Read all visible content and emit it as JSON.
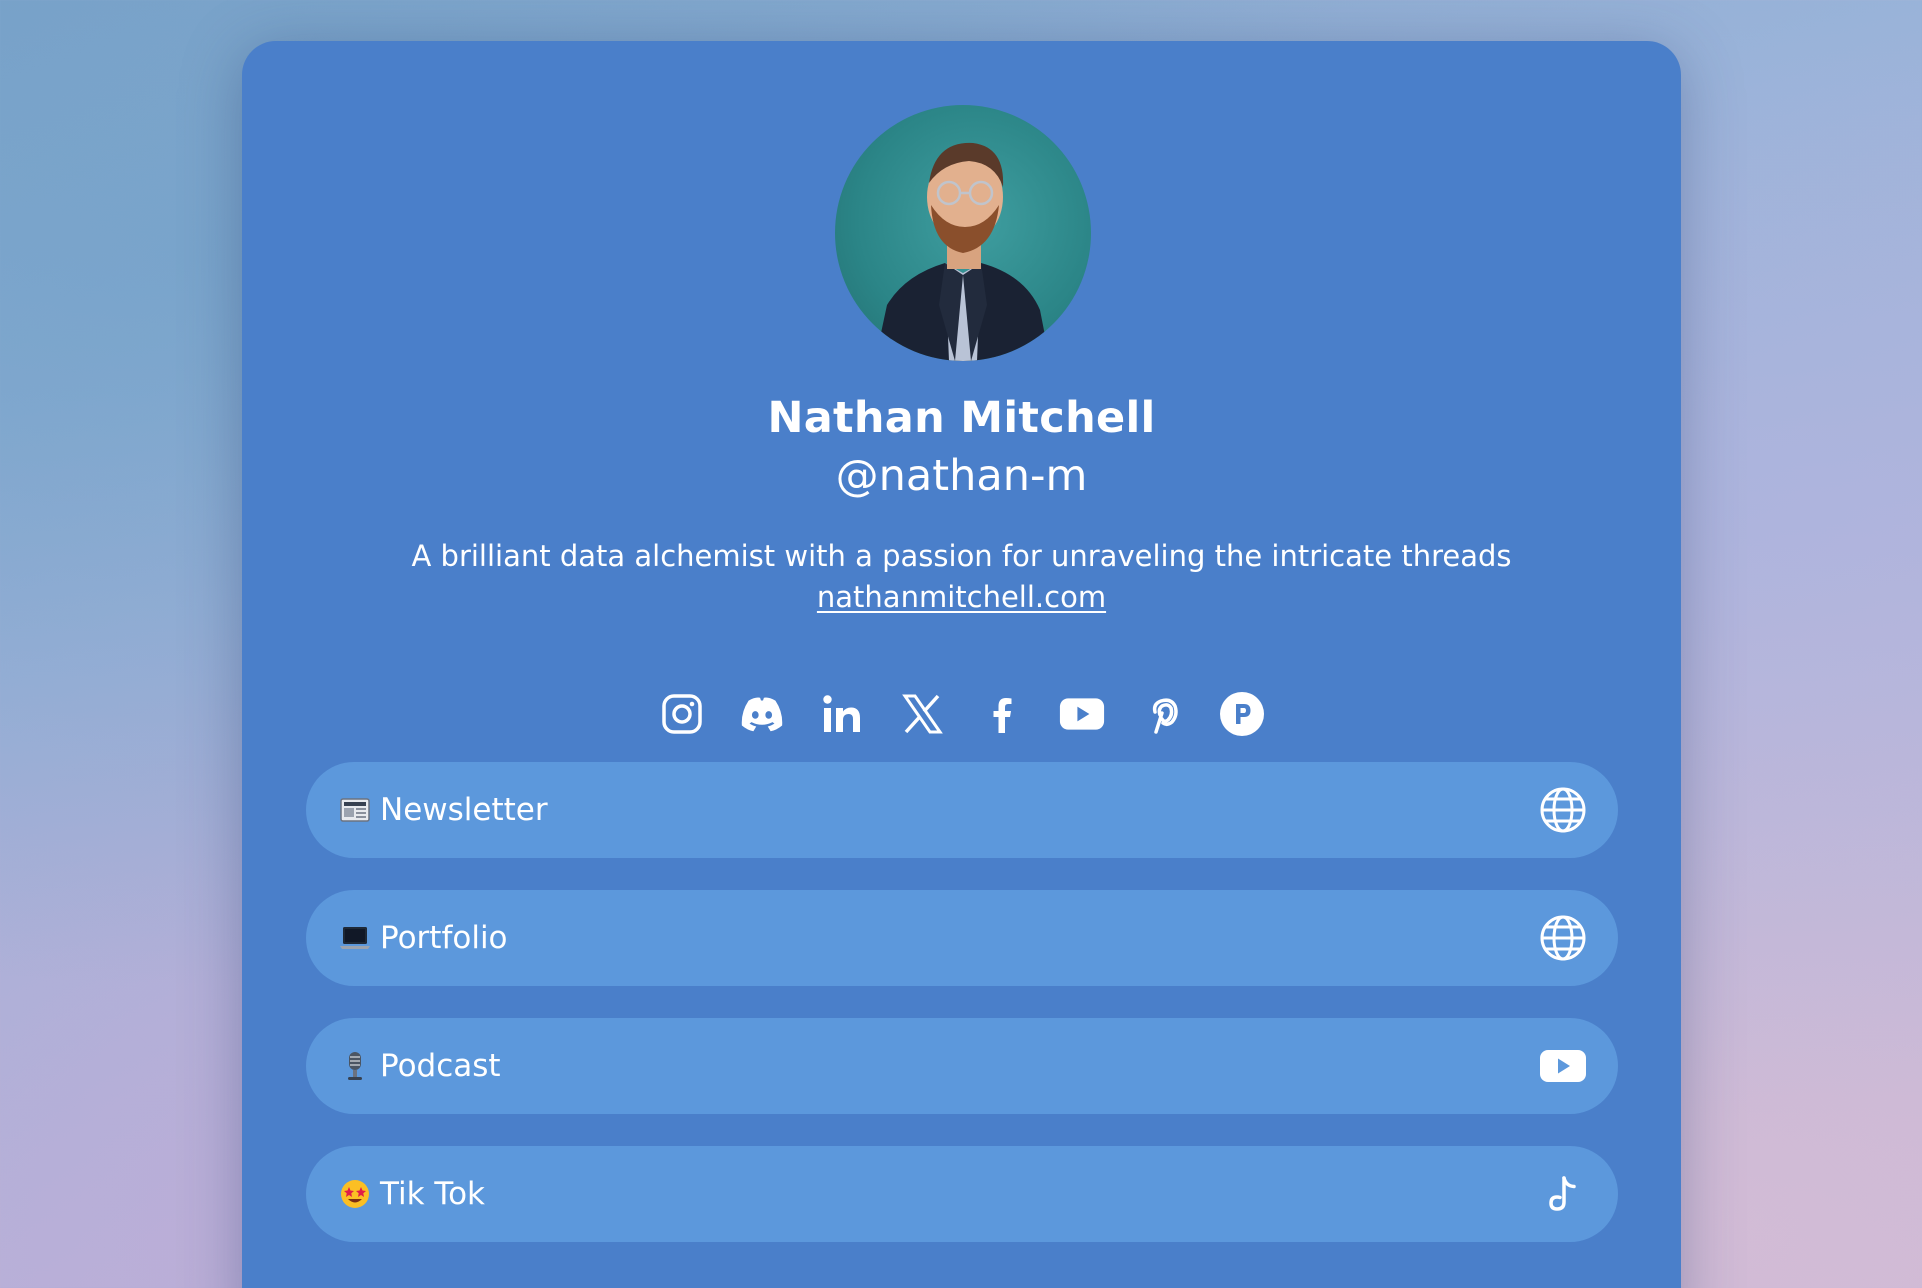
{
  "profile": {
    "name": "Nathan Mitchell",
    "handle": "@nathan-m",
    "bio": "A brilliant data alchemist with a passion for unraveling the intricate threads",
    "website": "nathanmitchell.com"
  },
  "socials": [
    {
      "icon": "instagram-icon"
    },
    {
      "icon": "discord-icon"
    },
    {
      "icon": "linkedin-icon"
    },
    {
      "icon": "x-twitter-icon"
    },
    {
      "icon": "facebook-icon"
    },
    {
      "icon": "youtube-icon"
    },
    {
      "icon": "pinterest-icon"
    },
    {
      "icon": "patreon-icon"
    }
  ],
  "links": [
    {
      "label": "Newsletter",
      "emoji": "newspaper-emoji",
      "icon": "globe-icon"
    },
    {
      "label": "Portfolio",
      "emoji": "laptop-emoji",
      "icon": "globe-icon"
    },
    {
      "label": "Podcast",
      "emoji": "microphone-emoji",
      "icon": "youtube-icon"
    },
    {
      "label": "Tik Tok",
      "emoji": "star-struck-emoji",
      "icon": "tiktok-icon"
    }
  ],
  "colors": {
    "card": "#4a7fca",
    "link_button": "#5c98dc",
    "text": "#ffffff"
  }
}
